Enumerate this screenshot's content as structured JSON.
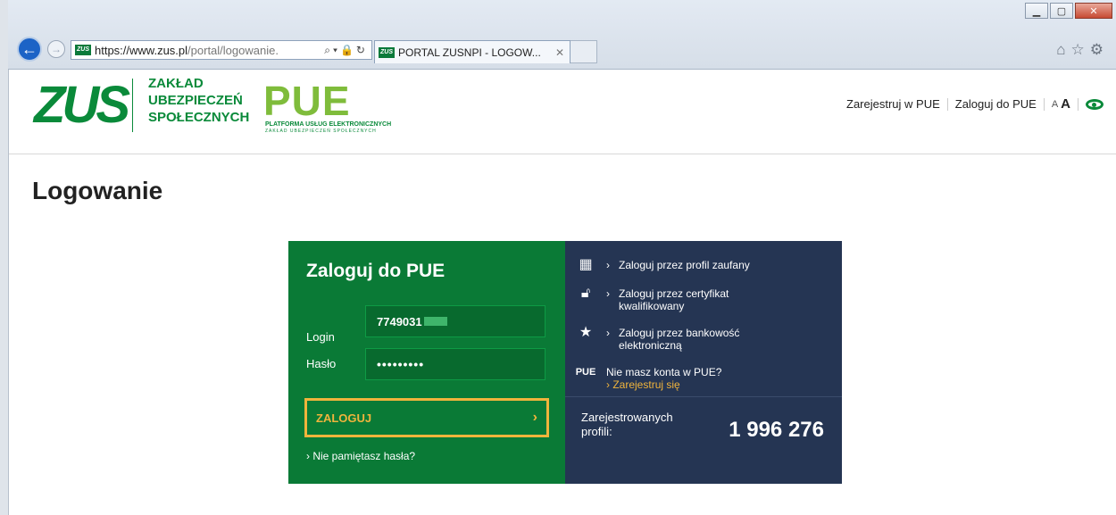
{
  "browser": {
    "url_host": "https://www.zus.pl",
    "url_rest": "/portal/logowanie.",
    "tab_title": "PORTAL ZUSNPI - LOGOW...",
    "favicon_text": "ZUS"
  },
  "header": {
    "logo": "ZUS",
    "org_name": [
      "ZAKŁAD",
      "UBEZPIECZEŃ",
      "SPOŁECZNYCH"
    ],
    "pue_logo": "PUE",
    "pue_subtitle": "PLATFORMA USŁUG ELEKTRONICZNYCH",
    "pue_subtitle2": "ZAKŁAD UBEZPIECZEŃ SPOŁECZNYCH",
    "links": {
      "register": "Zarejestruj w PUE",
      "login": "Zaloguj do PUE",
      "font_small": "A",
      "font_big": "A"
    }
  },
  "page": {
    "title": "Logowanie"
  },
  "login_form": {
    "title": "Zaloguj do PUE",
    "login_label": "Login",
    "login_value": "7749031",
    "password_label": "Hasło",
    "password_value": "•••••••••",
    "submit_label": "ZALOGUJ",
    "forgot_label": "Nie pamiętasz hasła?"
  },
  "alt_login": {
    "profile": "Zaloguj przez profil zaufany",
    "certificate_1": "Zaloguj przez certyfikat",
    "certificate_2": "kwalifikowany",
    "bank_1": "Zaloguj przez bankowość",
    "bank_2": "elektroniczną",
    "no_account": "Nie masz konta w PUE?",
    "register": "Zarejestruj się",
    "pue_mini": "PUE"
  },
  "stats": {
    "label_1": "Zarejestrowanych",
    "label_2": "profili:",
    "value": "1 996 276"
  },
  "colors": {
    "zus_green": "#0a8a3a",
    "panel_green": "#0a7a36",
    "panel_navy": "#253553",
    "accent_orange": "#f0b43c"
  }
}
